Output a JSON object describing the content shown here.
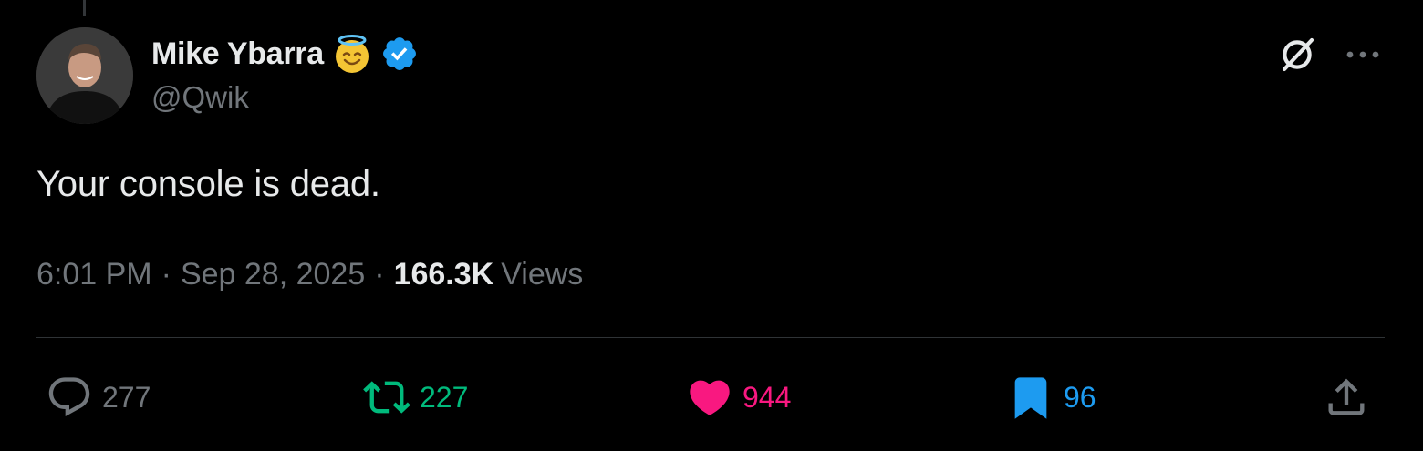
{
  "author": {
    "name": "Mike Ybarra",
    "handle": "@Qwik",
    "badge_emoji": "smiling-face-with-halo",
    "verified": true
  },
  "tweet": {
    "text": "Your console is dead."
  },
  "meta": {
    "time": "6:01 PM",
    "separator": "·",
    "date": "Sep 28, 2025",
    "views_count": "166.3K",
    "views_label": "Views"
  },
  "actions": {
    "replies": "277",
    "reposts": "227",
    "likes": "944",
    "bookmarks": "96"
  },
  "icons": {
    "grok": "grok-icon",
    "more": "more-icon",
    "reply": "reply-icon",
    "repost": "repost-icon",
    "like": "heart-icon",
    "bookmark": "bookmark-icon",
    "share": "share-icon"
  },
  "colors": {
    "background": "#000000",
    "text": "#e7e9ea",
    "muted": "#71767b",
    "verified": "#1d9bf0",
    "repost": "#00ba7c",
    "like": "#f91880",
    "bookmark": "#1d9bf0",
    "divider": "#2f3336"
  }
}
